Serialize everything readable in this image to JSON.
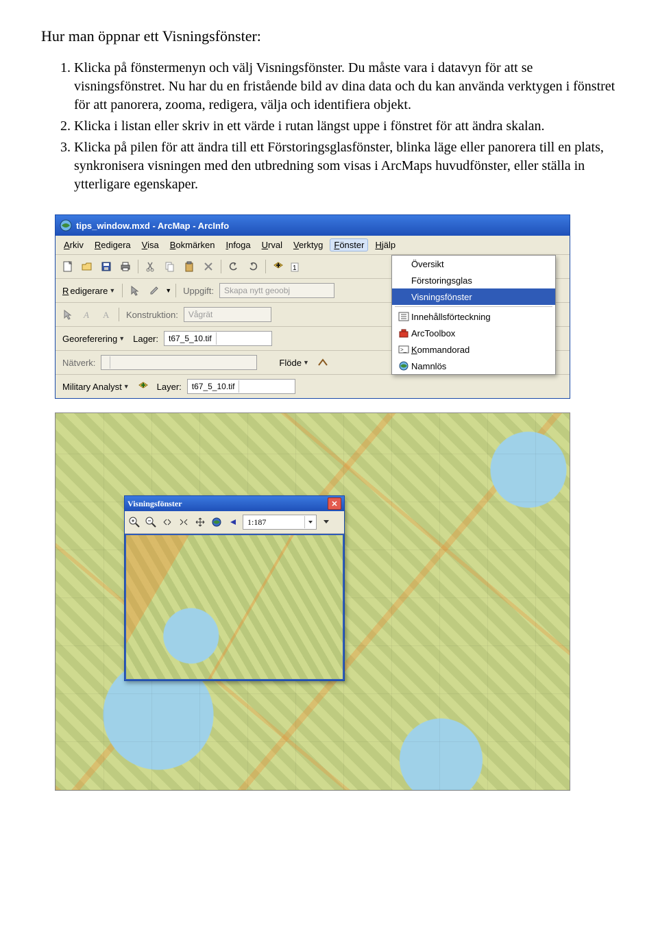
{
  "doc": {
    "heading": "Hur man öppnar ett Visningsfönster:",
    "steps": [
      "Klicka på fönstermenyn och välj Visningsfönster. Du måste vara i datavyn för att se visningsfönstret. Nu har du en fristående bild av dina data och du kan använda verktygen i fönstret för att panorera, zooma, redigera, välja och identifiera objekt.",
      "Klicka i listan eller skriv in ett värde i rutan längst uppe i fönstret för att ändra skalan.",
      "Klicka på pilen för att ändra till ett Förstoringsglasfönster, blinka läge eller panorera till en plats, synkronisera visningen med den utbredning som visas i ArcMaps huvudfönster, eller ställa in ytterligare egenskaper."
    ]
  },
  "arcmap": {
    "title": "tips_window.mxd - ArcMap - ArcInfo",
    "menubar": [
      "Arkiv",
      "Redigera",
      "Visa",
      "Bokmärken",
      "Infoga",
      "Urval",
      "Verktyg",
      "Fönster",
      "Hjälp"
    ],
    "open_menu": {
      "items": [
        {
          "icon": "",
          "label": "Översikt"
        },
        {
          "icon": "",
          "label": "Förstoringsglas"
        },
        {
          "icon": "",
          "label": "Visningsfönster",
          "selected": true
        }
      ],
      "sep_after": 2,
      "rest": [
        {
          "icon": "list",
          "label": "Innehållsförteckning"
        },
        {
          "icon": "toolbox",
          "label": "ArcToolbox"
        },
        {
          "icon": "cmd",
          "label": "Kommandorad"
        },
        {
          "icon": "globe",
          "label": "Namnlös"
        }
      ]
    },
    "row_editor": {
      "redigerare": "Redigerare",
      "uppgift": "Uppgift:",
      "skapa_ph": "Skapa nytt geoobj"
    },
    "row_konstruktion": {
      "label": "Konstruktion:",
      "value": "Vågrät"
    },
    "row_georef": {
      "label": "Georeferering",
      "lager": "Lager:",
      "value": "t67_5_10.tif"
    },
    "row_natverk": {
      "label": "Nätverk:",
      "flode": "Flöde"
    },
    "row_military": {
      "label": "Military Analyst",
      "layer": "Layer:",
      "value": "t67_5_10.tif"
    }
  },
  "viewer": {
    "title": "Visningsfönster",
    "scale": "1:187"
  }
}
